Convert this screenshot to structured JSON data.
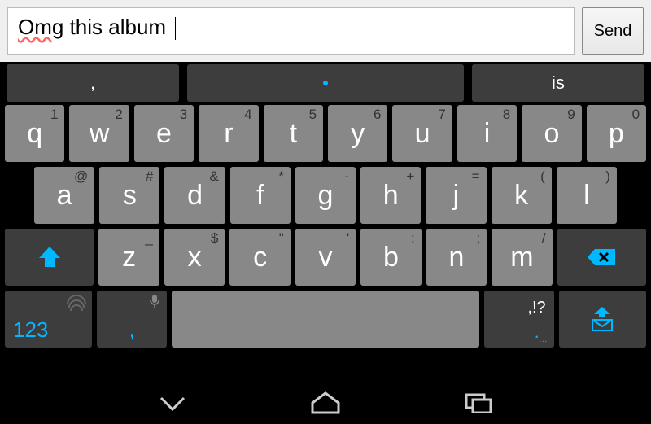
{
  "input": {
    "value_typo": "Omg",
    "value_rest": " this album ",
    "send_label": "Send"
  },
  "suggestions": {
    "left": ",",
    "middle": ".",
    "right": "is"
  },
  "row1": [
    {
      "main": "q",
      "hint": "1"
    },
    {
      "main": "w",
      "hint": "2"
    },
    {
      "main": "e",
      "hint": "3"
    },
    {
      "main": "r",
      "hint": "4"
    },
    {
      "main": "t",
      "hint": "5"
    },
    {
      "main": "y",
      "hint": "6"
    },
    {
      "main": "u",
      "hint": "7"
    },
    {
      "main": "i",
      "hint": "8"
    },
    {
      "main": "o",
      "hint": "9"
    },
    {
      "main": "p",
      "hint": "0"
    }
  ],
  "row2": [
    {
      "main": "a",
      "hint": "@"
    },
    {
      "main": "s",
      "hint": "#"
    },
    {
      "main": "d",
      "hint": "&"
    },
    {
      "main": "f",
      "hint": "*"
    },
    {
      "main": "g",
      "hint": "-"
    },
    {
      "main": "h",
      "hint": "+"
    },
    {
      "main": "j",
      "hint": "="
    },
    {
      "main": "k",
      "hint": "("
    },
    {
      "main": "l",
      "hint": ")"
    }
  ],
  "row3": [
    {
      "main": "z",
      "hint": "_"
    },
    {
      "main": "x",
      "hint": "$"
    },
    {
      "main": "c",
      "hint": "\""
    },
    {
      "main": "v",
      "hint": "'"
    },
    {
      "main": "b",
      "hint": ":"
    },
    {
      "main": "n",
      "hint": ";"
    },
    {
      "main": "m",
      "hint": "/"
    }
  ],
  "bottom": {
    "num_label": "123",
    "comma": ",",
    "period_alt": ",!?",
    "period_main": "."
  },
  "colors": {
    "accent": "#00b8ff",
    "key": "#888888",
    "key_dark": "#3d3d3d"
  }
}
